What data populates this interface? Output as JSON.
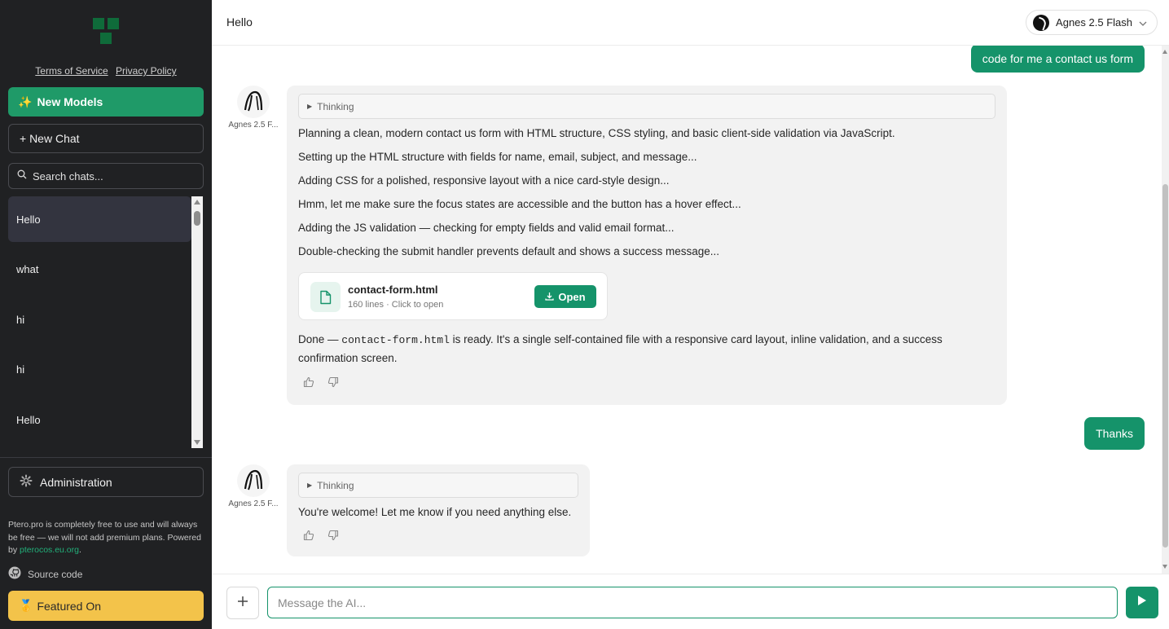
{
  "sidebar": {
    "logo": "app-logo",
    "terms_label": "Terms of Service",
    "privacy_label": "Privacy Policy",
    "new_models_icon": "✨",
    "new_models_label": "New Models",
    "new_chat_label": "+ New Chat",
    "search_placeholder": "Search chats...",
    "chats": [
      {
        "title": "Hello",
        "active": true
      },
      {
        "title": "what",
        "active": false
      },
      {
        "title": "hi",
        "active": false
      },
      {
        "title": "hi",
        "active": false
      },
      {
        "title": "Hello",
        "active": false
      }
    ],
    "admin_label": "Administration",
    "footer_note": "Ptero.pro is completely free to use and will always be free — we will not add premium plans. Powered by ",
    "footer_link": "pterocos.eu.org",
    "footer_end": ".",
    "source_code_label": "Source code",
    "featured_icon": "🥇",
    "featured_label": "Featured On"
  },
  "header": {
    "title": "Hello",
    "model_name": "Agnes 2.5 Flash"
  },
  "conversation": {
    "user_msg_1": "code for me a contact us form",
    "assistant_1": {
      "avatar_name": "Agnes 2.5 F...",
      "thinking_label": "Thinking",
      "lines": [
        "Planning a clean, modern contact us form with HTML structure, CSS styling, and basic client-side validation via JavaScript.",
        "Setting up the HTML structure with fields for name, email, subject, and message...",
        "Adding CSS for a polished, responsive layout with a nice card-style design...",
        "Hmm, let me make sure the focus states are accessible and the button has a hover effect...",
        "Adding the JS validation — checking for empty fields and valid email format...",
        "Double-checking the submit handler prevents default and shows a success message..."
      ],
      "file": {
        "name": "contact-form.html",
        "meta": "160 lines · Click to open",
        "open_label": "Open"
      },
      "done_prefix": "Done — ",
      "done_code": "contact-form.html",
      "done_suffix": " is ready. It's a single self-contained file with a responsive card layout, inline validation, and a success confirmation screen."
    },
    "user_msg_2": "Thanks",
    "assistant_2": {
      "avatar_name": "Agnes 2.5 F...",
      "thinking_label": "Thinking",
      "text": "You're welcome! Let me know if you need anything else."
    }
  },
  "composer": {
    "placeholder": "Message the AI..."
  },
  "colors": {
    "accent": "#15936a",
    "sidebar_bg": "#202123",
    "featured": "#f3c34a"
  }
}
